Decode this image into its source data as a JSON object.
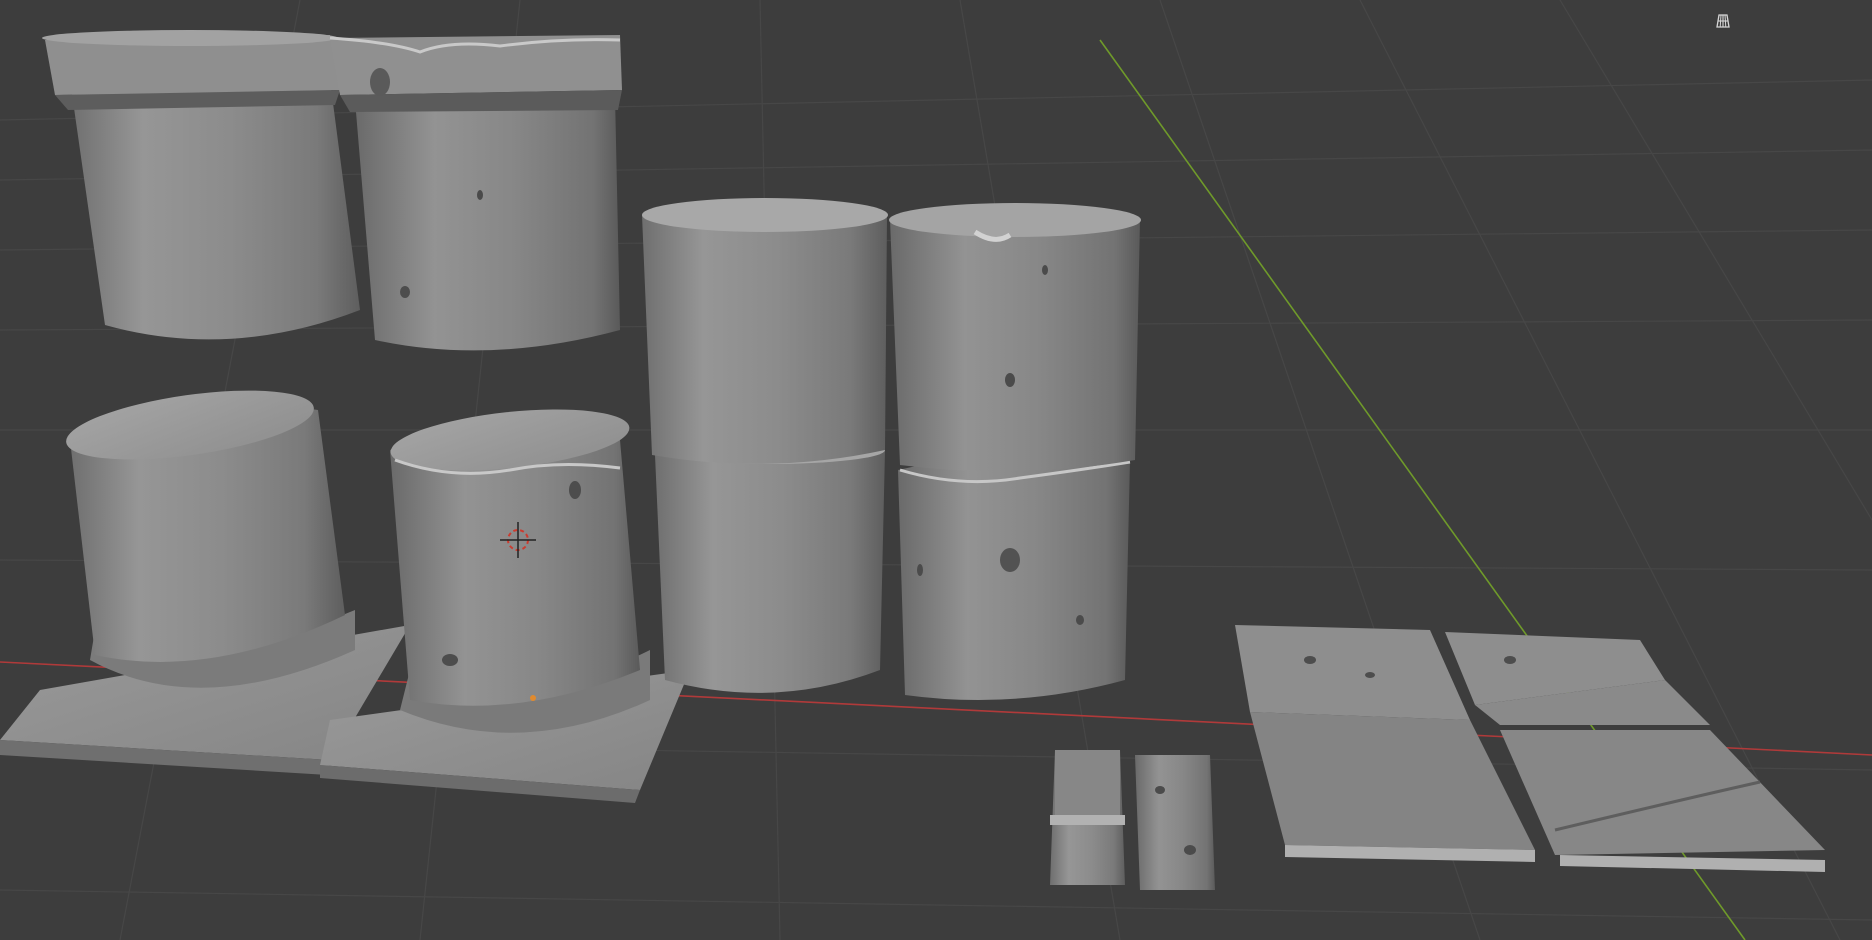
{
  "app": "3D Viewport",
  "viewport": {
    "background_color": "#3d3d3d",
    "grid_line_color": "#4a4a4a",
    "x_axis_color": "#b03a3a",
    "y_axis_color": "#6f9a2a",
    "shading": "solid",
    "object_color": "#8a8a8a"
  },
  "header_tools": {
    "grid_toggle_icon": "grid-floor-icon"
  },
  "cursor": {
    "icon": "3d-cursor-icon",
    "color": "#cc3b2f"
  },
  "origin_marker_color": "#e08a2e",
  "objects": [
    "column-capital-clean",
    "column-capital-damaged",
    "column-base-clean",
    "column-base-damaged",
    "column-drum-clean-upper",
    "column-drum-clean-lower",
    "column-drum-damaged-upper",
    "column-drum-damaged-lower",
    "brick-clean",
    "brick-damaged",
    "floor-tiles-clean-and-damaged",
    "floor-tiles-cracked"
  ]
}
